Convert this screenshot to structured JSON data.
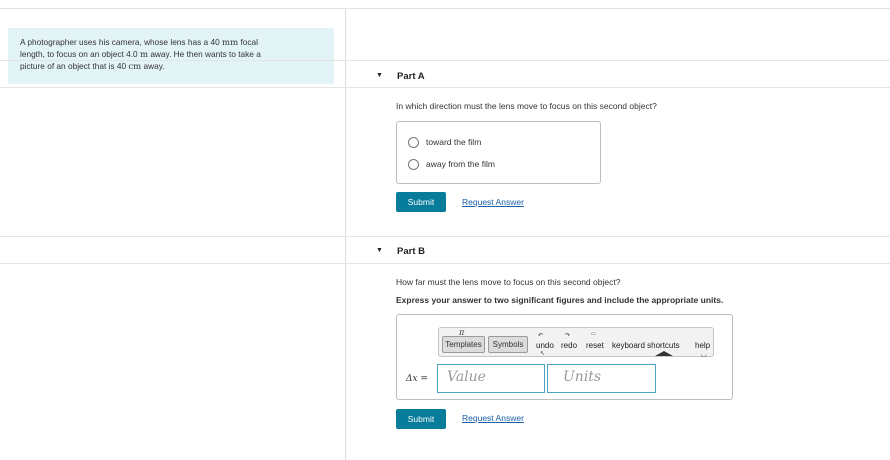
{
  "problem": {
    "line1_pre": "A photographer uses his camera, whose lens has a 40",
    "line1_unit": "mm",
    "line1_post": "focal",
    "line2_pre": "length, to focus on an object 4.0",
    "line2_unit": "m",
    "line2_post": "away. He then wants to take a",
    "line3_pre": "picture of an object that is 40",
    "line3_unit": "cm",
    "line3_post": "away."
  },
  "part_a": {
    "title": "Part A",
    "question": "In which direction must the lens move to focus on this second object?",
    "options": [
      "toward the film",
      "away from the film"
    ],
    "submit_label": "Submit",
    "request_label": "Request Answer"
  },
  "part_b": {
    "title": "Part B",
    "question": "How far must the lens move to focus on this second object?",
    "instruction": "Express your answer to two significant figures and include the appropriate units.",
    "toolbar": {
      "templates_label": "Templates",
      "symbols_label": "Symbols",
      "pi_glyph": "π",
      "undo_label": "undo",
      "redo_label": "redo",
      "reset_label": "reset",
      "keyboard_label": "keyboard shortcuts",
      "help_label": "help"
    },
    "variable_label": "Δx =",
    "value_placeholder": "Value",
    "units_placeholder": "Units",
    "submit_label": "Submit",
    "request_label": "Request Answer"
  },
  "icons": {
    "expand": "triangle-down",
    "radio": "circle-outline"
  },
  "colors": {
    "problem_bg": "#e3f4f7",
    "submit_bg": "#087c9b",
    "link": "#1a5fa8",
    "field_border": "#4aa3c0"
  }
}
